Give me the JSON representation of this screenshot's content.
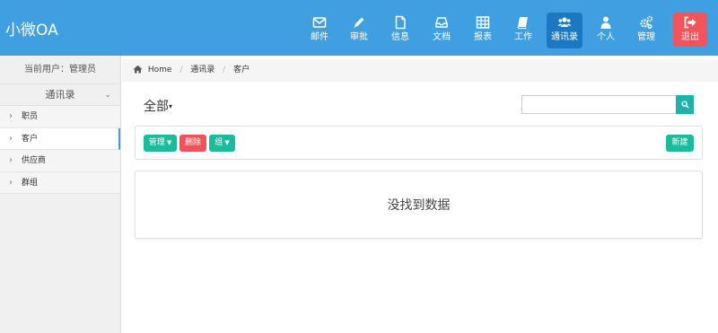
{
  "brand": "小微OA",
  "nav": [
    {
      "label": "邮件",
      "icon": "mail-icon"
    },
    {
      "label": "审批",
      "icon": "pencil-icon"
    },
    {
      "label": "信息",
      "icon": "file-icon"
    },
    {
      "label": "文档",
      "icon": "inbox-icon"
    },
    {
      "label": "报表",
      "icon": "table-icon"
    },
    {
      "label": "工作",
      "icon": "book-icon"
    },
    {
      "label": "通讯录",
      "icon": "users-icon",
      "active": true
    },
    {
      "label": "个人",
      "icon": "user-icon"
    },
    {
      "label": "管理",
      "icon": "gears-icon"
    },
    {
      "label": "退出",
      "icon": "sign-out-icon"
    }
  ],
  "sidebar": {
    "current_user": "当前用户：管理员",
    "section": "通讯录",
    "items": [
      {
        "label": "职员"
      },
      {
        "label": "客户",
        "active": true
      },
      {
        "label": "供应商"
      },
      {
        "label": "群组"
      }
    ]
  },
  "breadcrumb": {
    "home": "Home",
    "level1": "通讯录",
    "level2": "客户"
  },
  "main": {
    "filter": "全部",
    "search_placeholder": "",
    "buttons": {
      "manage": "管理",
      "delete": "删除",
      "group": "组",
      "new": "新建"
    },
    "empty_message": "没找到数据"
  },
  "colors": {
    "topbar": "#3f9fe0",
    "active_nav": "#1c78c2",
    "logout": "#f2545b",
    "teal": "#1abc9c",
    "danger": "#f0525a"
  }
}
